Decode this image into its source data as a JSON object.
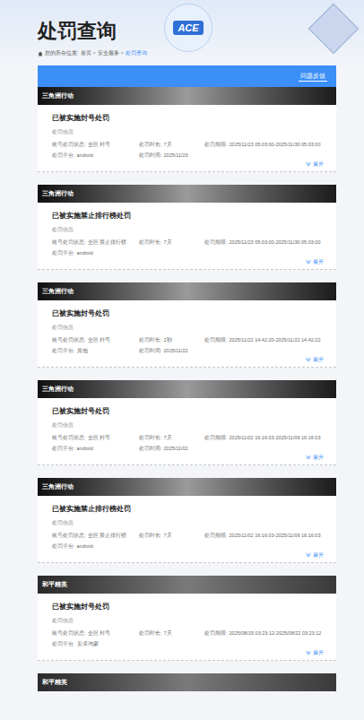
{
  "page": {
    "title": "处罚查询",
    "breadcrumb": {
      "label": "您的所在位置:",
      "separator": ">",
      "items": [
        {
          "label": "首页",
          "selected": false
        },
        {
          "label": "安全服务",
          "selected": false
        },
        {
          "label": "处罚查询",
          "selected": true
        }
      ]
    }
  },
  "logo": "ACE",
  "feedback_button": "问题反馈",
  "records": [
    {
      "kind": "full",
      "game": "三角洲行动",
      "title": "已被实施封号处罚",
      "section": "处罚信息",
      "expand": "展开",
      "fields": [
        {
          "label": "账号处罚状态:",
          "value": "全区 封号"
        },
        {
          "label": "处罚时长:",
          "value": "7天"
        },
        {
          "label": "处罚期限:",
          "value": "2025/11/23 05:03:00-2025/11/30 05:03:00"
        },
        {
          "label": "处罚平台:",
          "value": "android"
        },
        {
          "label": "处罚时间:",
          "value": "2025/11/23"
        }
      ]
    },
    {
      "kind": "full",
      "game": "三角洲行动",
      "title": "已被实施禁止排行榜处罚",
      "section": "处罚信息",
      "expand": "展开",
      "fields": [
        {
          "label": "账号处罚状态:",
          "value": "全区 禁止排行榜"
        },
        {
          "label": "处罚时长:",
          "value": "7天"
        },
        {
          "label": "处罚期限:",
          "value": "2025/11/23 05:03:00-2025/11/30 05:03:00"
        },
        {
          "label": "处罚平台:",
          "value": "android"
        }
      ]
    },
    {
      "kind": "full",
      "game": "三角洲行动",
      "title": "已被实施封号处罚",
      "section": "处罚信息",
      "expand": "展开",
      "fields": [
        {
          "label": "账号处罚状态:",
          "value": "全区 封号"
        },
        {
          "label": "处罚时长:",
          "value": "2秒"
        },
        {
          "label": "处罚期限:",
          "value": "2025/11/22 14:42:20-2025/11/22 14:42:22"
        },
        {
          "label": "处罚平台:",
          "value": "其他"
        },
        {
          "label": "处罚时间:",
          "value": "2025/11/22"
        }
      ]
    },
    {
      "kind": "full",
      "game": "三角洲行动",
      "title": "已被实施封号处罚",
      "section": "处罚信息",
      "expand": "展开",
      "fields": [
        {
          "label": "账号处罚状态:",
          "value": "全区 封号"
        },
        {
          "label": "处罚时长:",
          "value": "7天"
        },
        {
          "label": "处罚期限:",
          "value": "2025/11/02 16:16:03-2025/11/09 16:16:03"
        },
        {
          "label": "处罚平台:",
          "value": "android"
        },
        {
          "label": "处罚时间:",
          "value": "2025/11/02"
        }
      ]
    },
    {
      "kind": "full",
      "game": "三角洲行动",
      "title": "已被实施禁止排行榜处罚",
      "section": "处罚信息",
      "expand": "展开",
      "fields": [
        {
          "label": "账号处罚状态:",
          "value": "全区 禁止排行榜"
        },
        {
          "label": "处罚时长:",
          "value": "7天"
        },
        {
          "label": "处罚期限:",
          "value": "2025/11/02 16:16:03-2025/11/09 16:16:03"
        },
        {
          "label": "处罚平台:",
          "value": "android"
        }
      ]
    },
    {
      "kind": "full",
      "game": "和平精英",
      "title": "已被实施封号处罚",
      "section": "处罚信息",
      "expand": "展开",
      "fields": [
        {
          "label": "账号处罚状态:",
          "value": "全区 封号"
        },
        {
          "label": "处罚时长:",
          "value": "7天"
        },
        {
          "label": "处罚期限:",
          "value": "2025/08/15 03:23:12-2025/08/22 03:23:12"
        },
        {
          "label": "处罚平台:",
          "value": "安卓鸿蒙"
        }
      ]
    },
    {
      "kind": "banner-only",
      "game": "和平精英"
    }
  ]
}
